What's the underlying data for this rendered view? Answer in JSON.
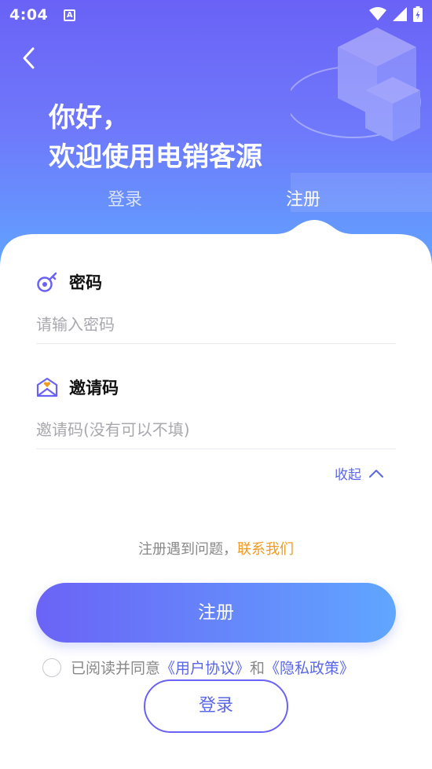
{
  "status_bar": {
    "time": "4:04",
    "notification_letter": "A"
  },
  "header": {
    "greeting_line1": "你好，",
    "greeting_line2": "欢迎使用电销客源"
  },
  "tabs": {
    "login": "登录",
    "register": "注册",
    "active": "register"
  },
  "form": {
    "password": {
      "label": "密码",
      "placeholder": "请输入密码",
      "value": ""
    },
    "invite": {
      "label": "邀请码",
      "placeholder": "邀请码(没有可以不填)",
      "value": ""
    },
    "collapse_label": "收起"
  },
  "help": {
    "text": "注册遇到问题，",
    "link": "联系我们"
  },
  "register_button": "注册",
  "agreement": {
    "prefix": "已阅读并同意",
    "user_agreement": "《用户协议》",
    "and": "和",
    "privacy_policy": "《隐私政策》",
    "checked": false
  },
  "login_button": "登录",
  "colors": {
    "primary": "#6a62f6",
    "accent_blue": "#5fa8ff",
    "link": "#5a67e8",
    "contact_link": "#f29a1f"
  }
}
